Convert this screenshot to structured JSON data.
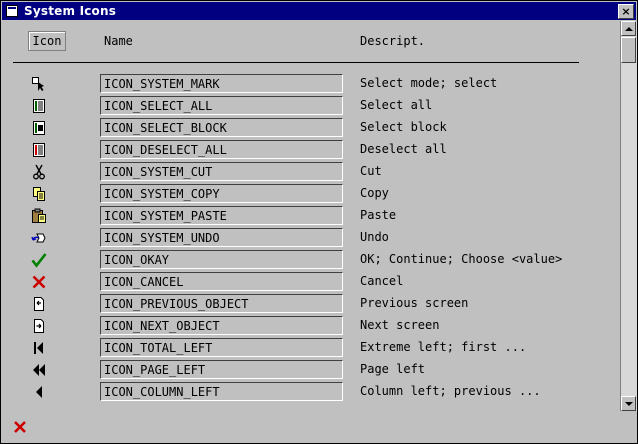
{
  "window": {
    "title": "System Icons",
    "close_glyph": "×"
  },
  "columns": {
    "icon": "Icon",
    "name": "Name",
    "description": "Descript."
  },
  "rows": [
    {
      "icon": "system-mark-icon",
      "name": "ICON_SYSTEM_MARK",
      "description": "Select mode; select"
    },
    {
      "icon": "select-all-icon",
      "name": "ICON_SELECT_ALL",
      "description": "Select all"
    },
    {
      "icon": "select-block-icon",
      "name": "ICON_SELECT_BLOCK",
      "description": "Select block"
    },
    {
      "icon": "deselect-all-icon",
      "name": "ICON_DESELECT_ALL",
      "description": "Deselect all"
    },
    {
      "icon": "scissors-icon",
      "name": "ICON_SYSTEM_CUT",
      "description": "Cut"
    },
    {
      "icon": "copy-icon",
      "name": "ICON_SYSTEM_COPY",
      "description": "Copy"
    },
    {
      "icon": "paste-icon",
      "name": "ICON_SYSTEM_PASTE",
      "description": "Paste"
    },
    {
      "icon": "undo-icon",
      "name": "ICON_SYSTEM_UNDO",
      "description": "Undo"
    },
    {
      "icon": "checkmark-icon",
      "name": "ICON_OKAY",
      "description": "OK; Continue; Choose <value>"
    },
    {
      "icon": "cancel-x-icon",
      "name": "ICON_CANCEL",
      "description": "Cancel"
    },
    {
      "icon": "previous-object-icon",
      "name": "ICON_PREVIOUS_OBJECT",
      "description": "Previous screen"
    },
    {
      "icon": "next-object-icon",
      "name": "ICON_NEXT_OBJECT",
      "description": "Next screen"
    },
    {
      "icon": "total-left-icon",
      "name": "ICON_TOTAL_LEFT",
      "description": "Extreme left; first ..."
    },
    {
      "icon": "page-left-icon",
      "name": "ICON_PAGE_LEFT",
      "description": "Page left"
    },
    {
      "icon": "column-left-icon",
      "name": "ICON_COLUMN_LEFT",
      "description": "Column left; previous ..."
    }
  ],
  "colors": {
    "titlebar": "#000080",
    "background": "#c0c0c0",
    "ok": "#008000",
    "cancel": "#cc0000"
  }
}
